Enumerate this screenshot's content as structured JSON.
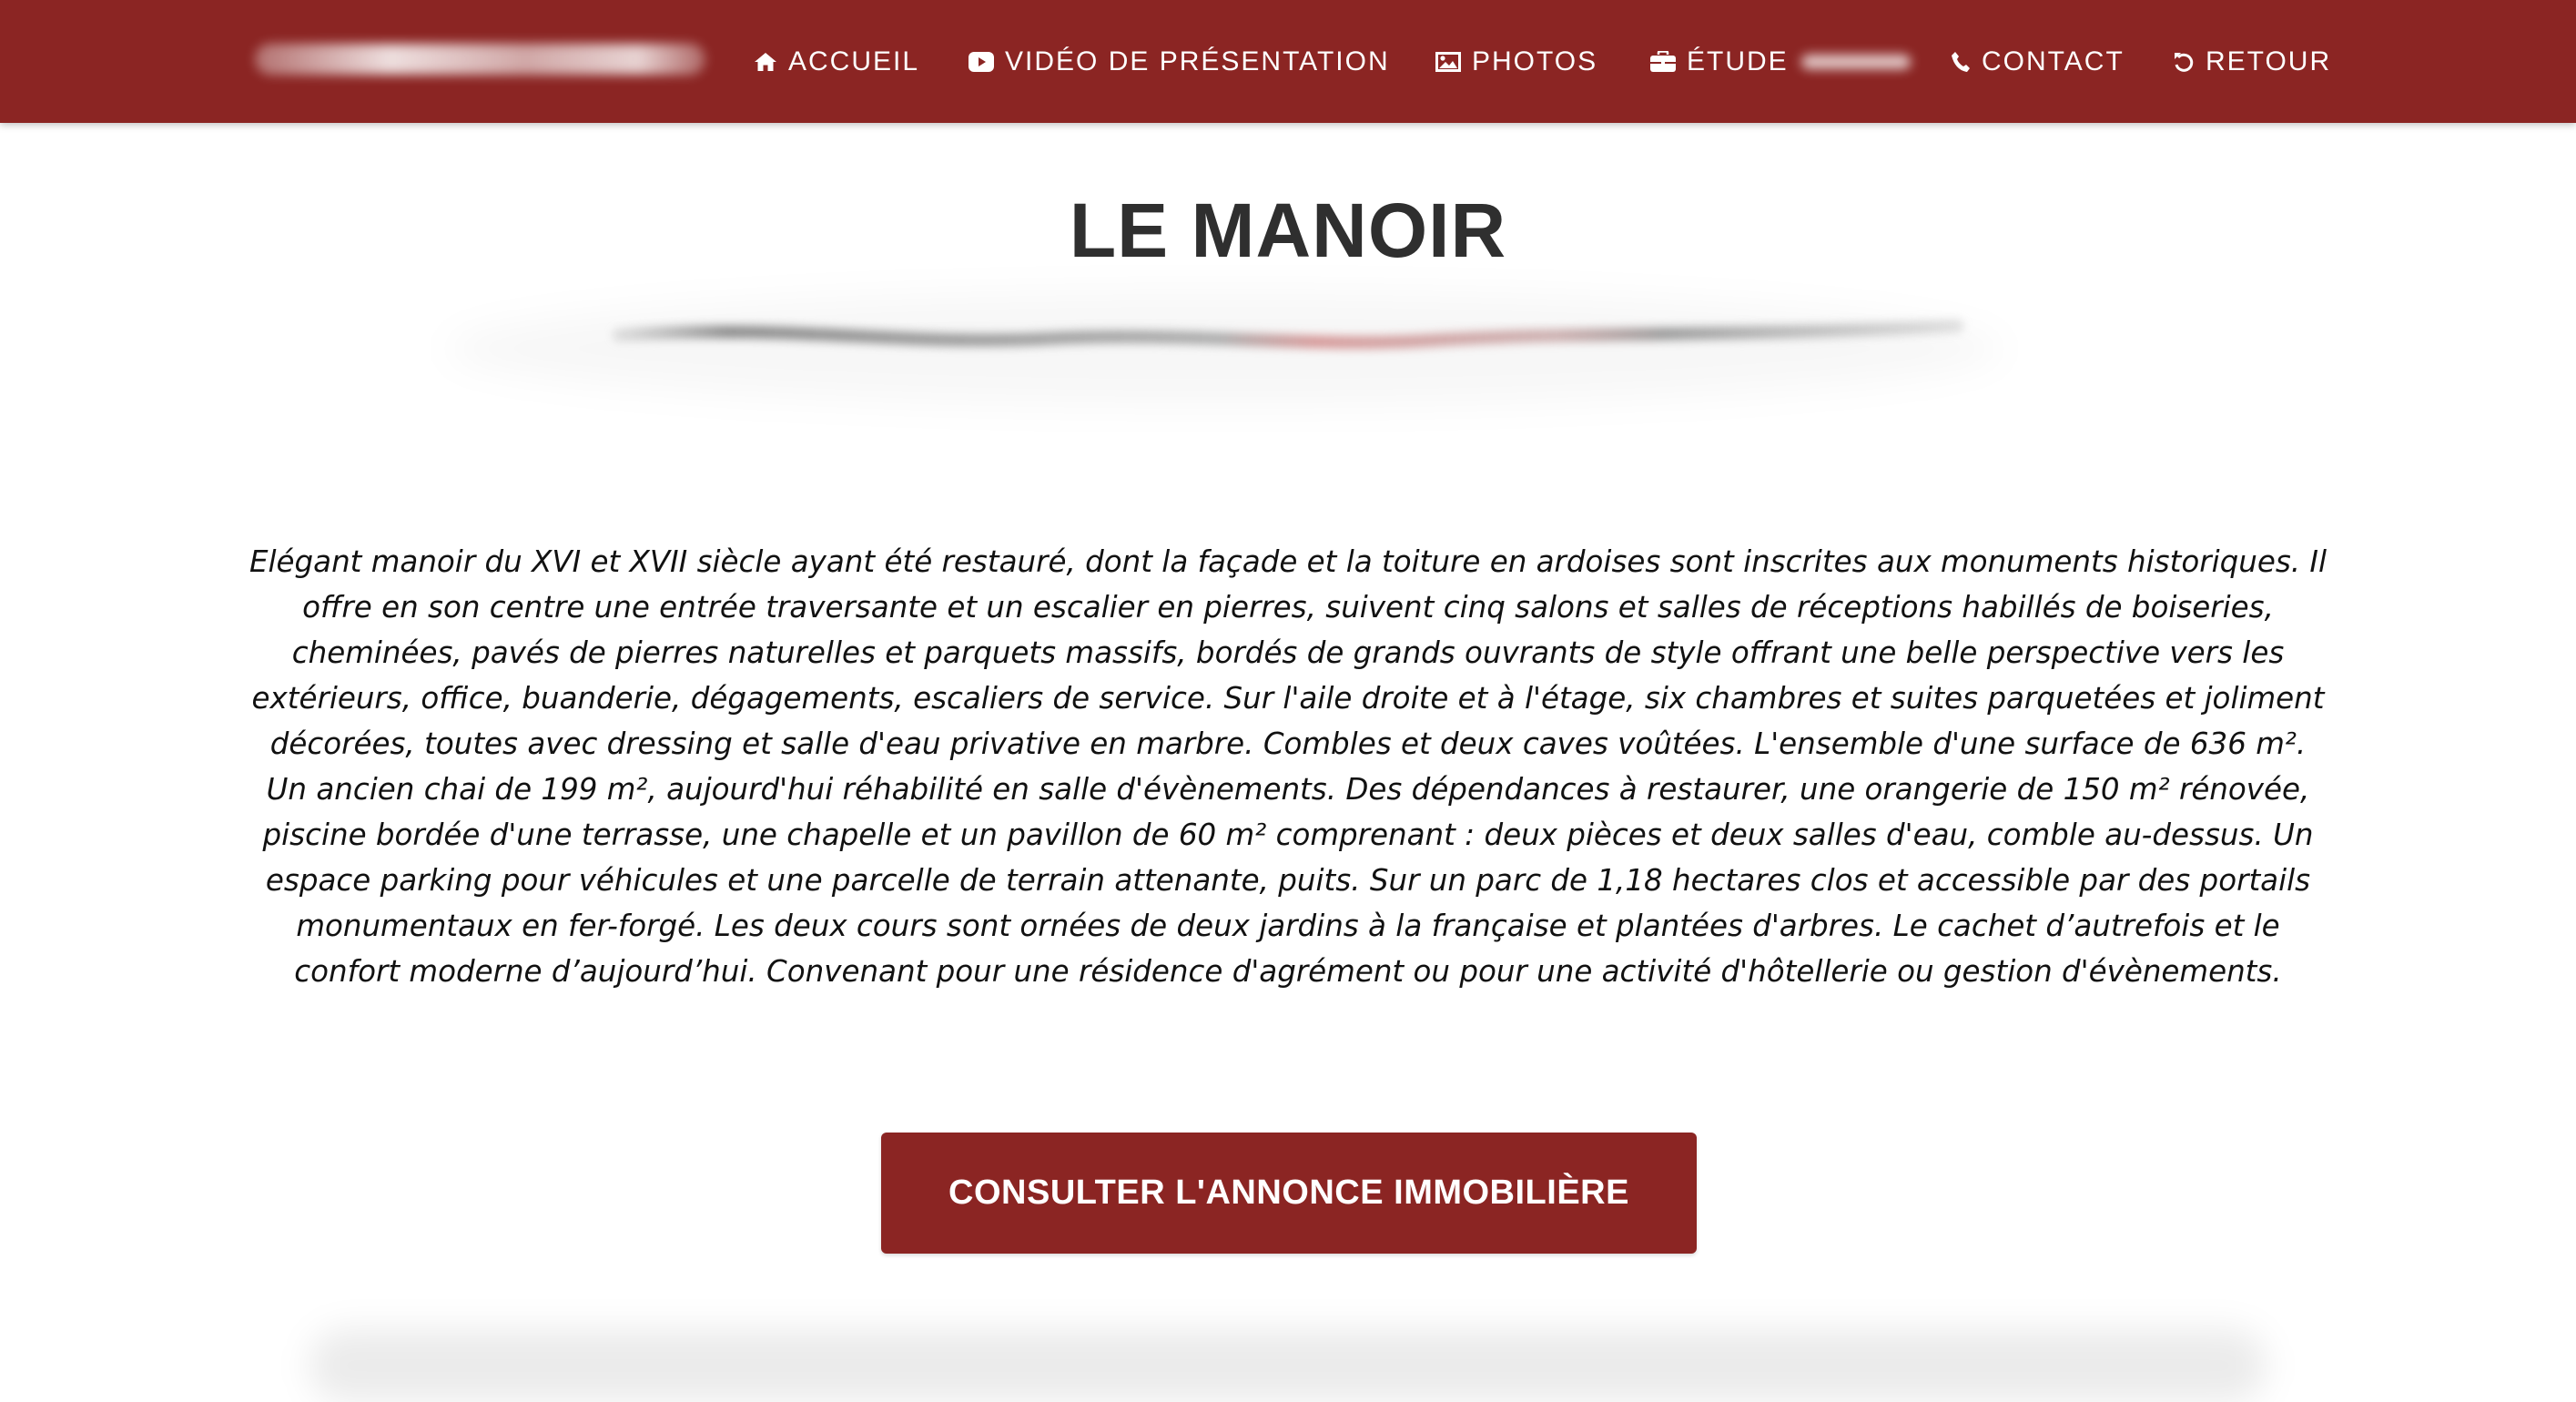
{
  "navbar": {
    "background_color": "#8b2523",
    "items": [
      {
        "label": "ACCUEIL",
        "icon": "home-icon"
      },
      {
        "label": "VIDÉO DE PRÉSENTATION",
        "icon": "youtube-play-icon"
      },
      {
        "label": "PHOTOS",
        "icon": "image-icon"
      },
      {
        "label": "ÉTUDE",
        "icon": "briefcase-icon"
      },
      {
        "label": "CONTACT",
        "icon": "phone-icon"
      },
      {
        "label": "RETOUR",
        "icon": "undo-icon"
      }
    ]
  },
  "main": {
    "title": "LE MANOIR",
    "description": "Elégant manoir du XVI et XVII siècle ayant été restauré, dont la façade et la toiture en ardoises sont inscrites aux monuments historiques. Il offre en son centre une entrée traversante et un escalier en pierres, suivent cinq salons et salles de réceptions habillés de boiseries, cheminées, pavés de pierres naturelles et parquets massifs, bordés de grands ouvrants de style offrant une belle perspective vers les extérieurs, office, buanderie, dégagements, escaliers de service. Sur l'aile droite et à l'étage, six chambres et suites parquetées et joliment décorées, toutes avec dressing et salle d'eau privative en marbre. Combles et deux caves voûtées. L'ensemble d'une surface de 636 m². Un ancien chai de 199 m², aujourd'hui réhabilité en salle d'évènements. Des dépendances à restaurer, une orangerie de 150 m² rénovée, piscine bordée d'une terrasse, une chapelle et un pavillon de 60 m² comprenant : deux pièces et deux salles d'eau, comble au-dessus. Un espace parking pour véhicules et une parcelle de terrain attenante, puits. Sur un parc de 1,18 hectares clos et accessible par des portails monumentaux en fer-forgé. Les deux cours sont ornées de deux jardins à la française et plantées d'arbres. Le cachet d’autrefois et le confort moderne d’aujourd’hui. Convenant pour une résidence d'agrément ou pour une activité d'hôtellerie ou gestion d'évènements.",
    "cta_label": "CONSULTER L'ANNONCE IMMOBILIÈRE",
    "accent_color": "#8b2523"
  }
}
